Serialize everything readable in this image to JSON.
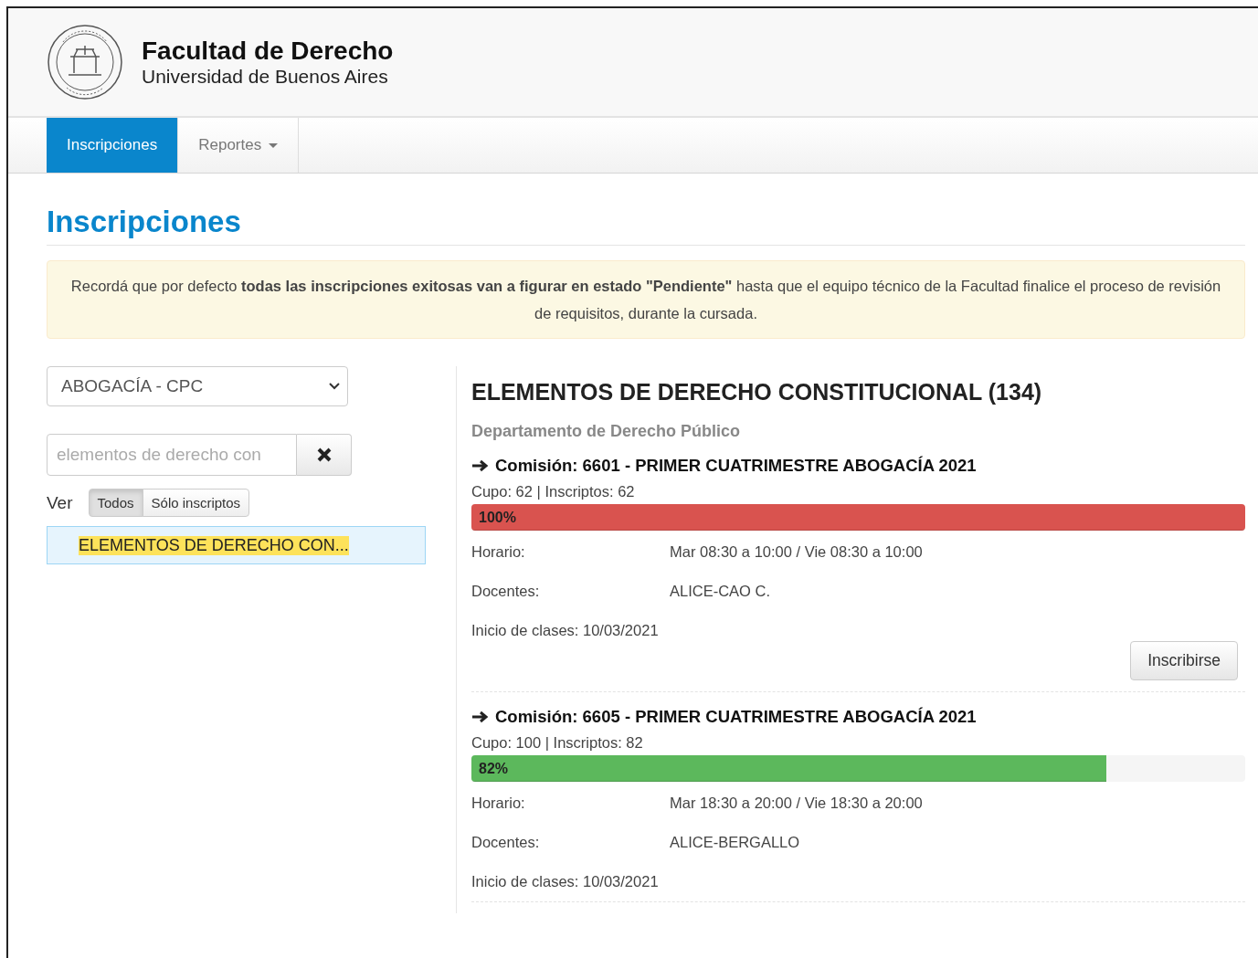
{
  "header": {
    "title": "Facultad de Derecho",
    "subtitle": "Universidad de Buenos Aires"
  },
  "nav": [
    {
      "label": "Inscripciones",
      "selected": true,
      "dropdown": false
    },
    {
      "label": "Reportes",
      "selected": false,
      "dropdown": true
    }
  ],
  "page_title": "Inscripciones",
  "alert": "Recordá que por defecto **todas las inscripciones exitosas van a figurar en estado \"Pendiente\"** hasta que el equipo técnico de la Facultad finalice el proceso de revisión de requisitos, durante la cursada.",
  "sidebar": {
    "career_select": "ABOGACÍA - CPC",
    "search_value": "elementos de derecho con",
    "filter_label": "Ver",
    "filters": [
      {
        "label": "Todos",
        "selected": true
      },
      {
        "label": "Sólo inscriptos",
        "selected": false
      }
    ],
    "results": [
      {
        "label": "ELEMENTOS DE DERECHO CON...",
        "selected": true
      }
    ]
  },
  "course": {
    "title": "ELEMENTOS DE DERECHO CONSTITUCIONAL (134)",
    "department": "Departamento de Derecho Público",
    "commissions": [
      {
        "title": "Comisión: 6601 - PRIMER CUATRIMESTRE ABOGACÍA 2021",
        "quota": "Cupo: 62 | Inscriptos: 62",
        "level": 1,
        "reading": "100%",
        "color": "#d9534f",
        "schedule_label": "Horario:",
        "schedule": "Mar 08:30 a 10:00 / Vie 08:30 a 10:00",
        "teachers_label": "Docentes:",
        "teachers": "ALICE-CAO C.",
        "start": "Inicio de clases: 10/03/2021",
        "button": "Inscribirse"
      },
      {
        "title": "Comisión: 6605 - PRIMER CUATRIMESTRE ABOGACÍA 2021",
        "quota": "Cupo: 100 | Inscriptos: 82",
        "level": 0.82,
        "reading": "82%",
        "color": "#5cb85c",
        "schedule_label": "Horario:",
        "schedule": "Mar 18:30 a 20:00 / Vie 18:30 a 20:00",
        "teachers_label": "Docentes:",
        "teachers": "ALICE-BERGALLO",
        "start": "Inicio de clases: 10/03/2021"
      }
    ]
  }
}
